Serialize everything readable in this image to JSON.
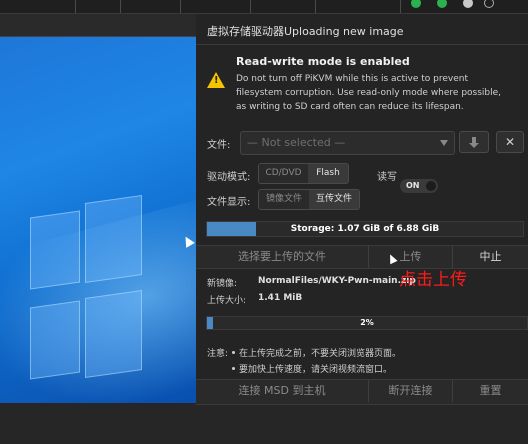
{
  "panel": {
    "title": "虚拟存储驱动器Uploading new image",
    "warning": {
      "icon": "warning-icon",
      "title": "Read-write mode is enabled",
      "body": "Do not turn off PiKVM while this is active to prevent filesystem corruption. Use read-only mode where possible, as writing to SD card often can reduce its lifespan."
    },
    "file_label": "文件:",
    "file_placeholder": "— Not selected —",
    "download_icon": "download-icon",
    "delete_icon": "close-icon",
    "drive_mode_label": "驱动模式:",
    "drive_mode_options": [
      "CD/DVD",
      "Flash"
    ],
    "drive_mode_selected": "Flash",
    "rw_label": "读写",
    "rw_toggle": "ON",
    "file_display_label": "文件显示:",
    "file_display_options": [
      "镜像文件",
      "互传文件"
    ],
    "file_display_selected": "互传文件",
    "storage_text": "Storage: 1.07 GiB of 6.88 GiB",
    "storage_fraction": 0.155,
    "select_upload": "选择要上传的文件",
    "upload_button": "上传",
    "abort_button": "中止",
    "new_image_label": "新镜像:",
    "new_image_value": "NormalFiles/WKY-Pwn-main.zip",
    "upload_size_label": "上传大小:",
    "upload_size_value": "1.41 MiB",
    "progress_text": "2%",
    "progress_fraction": 0.02,
    "notes_label": "注意:",
    "notes": [
      "在上传完成之前，不要关闭浏览器页面。",
      "要加快上传速度，请关闭视频流窗口。"
    ],
    "connect_button": "连接 MSD 到主机",
    "disconnect_button": "断开连接",
    "reset_button": "重置"
  },
  "annotation": "点击上传",
  "colors": {
    "accent": "#4a8ac4",
    "annotation": "#ff1a1a",
    "warning": "#f5c400"
  }
}
